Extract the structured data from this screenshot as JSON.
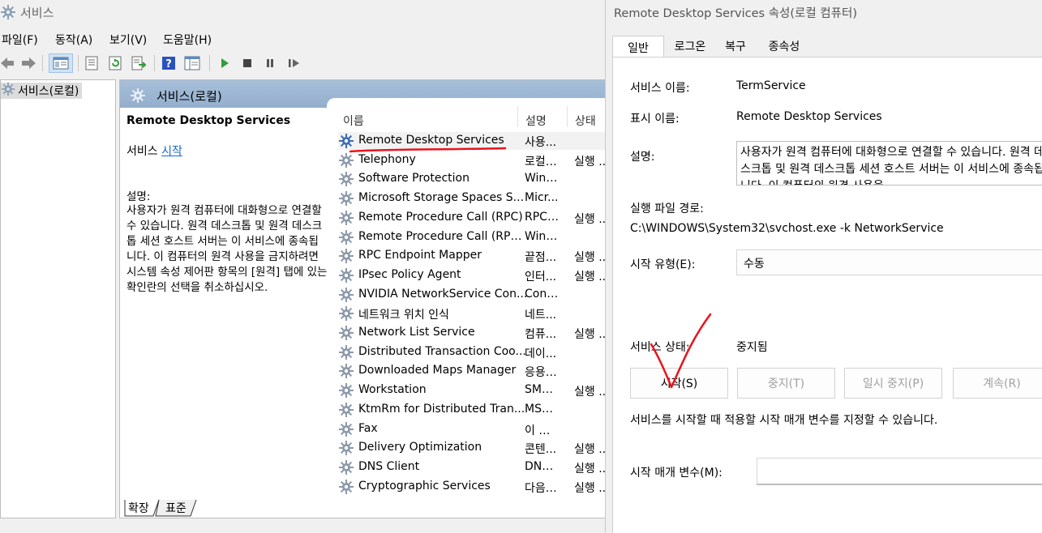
{
  "main": {
    "title": "서비스",
    "menu": [
      "파일(F)",
      "동작(A)",
      "보기(V)",
      "도움말(H)"
    ],
    "tree_item": "서비스(로컬)",
    "header": "서비스(로컬)",
    "detail": {
      "name": "Remote Desktop Services",
      "start_prefix": "서비스 ",
      "start_link": "시작",
      "desc_label": "설명:",
      "desc_text": "사용자가 원격 컴퓨터에 대화형으로 연결할 수 있습니다. 원격 데스크톱 및 원격 데스크톱 세션 호스트 서버는 이 서비스에 종속됩니다. 이 컴퓨터의 원격 사용을 금지하려면 시스템 속성 제어판 항목의 [원격] 탭에 있는 확인란의 선택을 취소하십시오."
    },
    "columns": [
      "이름",
      "설명",
      "상태"
    ],
    "rows": [
      {
        "name": "Remote Desktop Services",
        "desc": "사용...",
        "status": ""
      },
      {
        "name": "Telephony",
        "desc": "로컬 ...",
        "status": "실행 ..."
      },
      {
        "name": "Software Protection",
        "desc": "Wind...",
        "status": ""
      },
      {
        "name": "Microsoft Storage Spaces S...",
        "desc": "Micr...",
        "status": ""
      },
      {
        "name": "Remote Procedure Call (RPC)",
        "desc": "RPCS...",
        "status": "실행 ..."
      },
      {
        "name": "Remote Procedure Call (RPC...",
        "desc": "Wind...",
        "status": ""
      },
      {
        "name": "RPC Endpoint Mapper",
        "desc": "끝점...",
        "status": "실행 ..."
      },
      {
        "name": "IPsec Policy Agent",
        "desc": "인터...",
        "status": "실행 ..."
      },
      {
        "name": "NVIDIA NetworkService Con...",
        "desc": "Cont...",
        "status": ""
      },
      {
        "name": "네트워크 위치 인식",
        "desc": "네트...",
        "status": ""
      },
      {
        "name": "Network List Service",
        "desc": "컴퓨...",
        "status": "실행 ..."
      },
      {
        "name": "Distributed Transaction Coo...",
        "desc": "데이...",
        "status": ""
      },
      {
        "name": "Downloaded Maps Manager",
        "desc": "응용 ...",
        "status": ""
      },
      {
        "name": "Workstation",
        "desc": "SMB ...",
        "status": "실행 ..."
      },
      {
        "name": "KtmRm for Distributed Tran...",
        "desc": "MSD...",
        "status": ""
      },
      {
        "name": "Fax",
        "desc": "이 컴...",
        "status": ""
      },
      {
        "name": "Delivery Optimization",
        "desc": "콘텐...",
        "status": "실행 ..."
      },
      {
        "name": "DNS Client",
        "desc": "DNS ...",
        "status": "실행 ..."
      },
      {
        "name": "Cryptographic Services",
        "desc": "다음 ...",
        "status": "실행 ..."
      }
    ],
    "bottom_tabs": [
      "확장",
      "표준"
    ]
  },
  "dialog": {
    "title": "Remote Desktop Services 속성(로컬 컴퓨터)",
    "tabs": [
      "일반",
      "로그온",
      "복구",
      "종속성"
    ],
    "service_name_label": "서비스 이름:",
    "service_name": "TermService",
    "display_name_label": "표시 이름:",
    "display_name": "Remote Desktop Services",
    "description_label": "설명:",
    "description": "사용자가 원격 컴퓨터에 대화형으로 연결할 수 있습니다. 원격 데스크톱 및 원격 데스크톱 세션 호스트 서버는 이 서비스에 종속됩니다. 이 컴퓨터의 원격 사용을",
    "exe_path_label": "실행 파일 경로:",
    "exe_path": "C:\\WINDOWS\\System32\\svchost.exe -k NetworkService",
    "startup_type_label": "시작 유형(E):",
    "startup_type": "수동",
    "service_status_label": "서비스 상태:",
    "service_status": "중지됨",
    "buttons": {
      "start": "시작(S)",
      "stop": "중지(T)",
      "pause": "일시 중지(P)",
      "resume": "계속(R)"
    },
    "hint": "서비스를 시작할 때 적용할 시작 매개 변수를 지정할 수 있습니다.",
    "params_label": "시작 매개 변수(M):",
    "params_value": ""
  },
  "colors": {
    "annotation": "#e8141e",
    "link": "#1b6ac9",
    "header_bg": "#9db7d5"
  }
}
